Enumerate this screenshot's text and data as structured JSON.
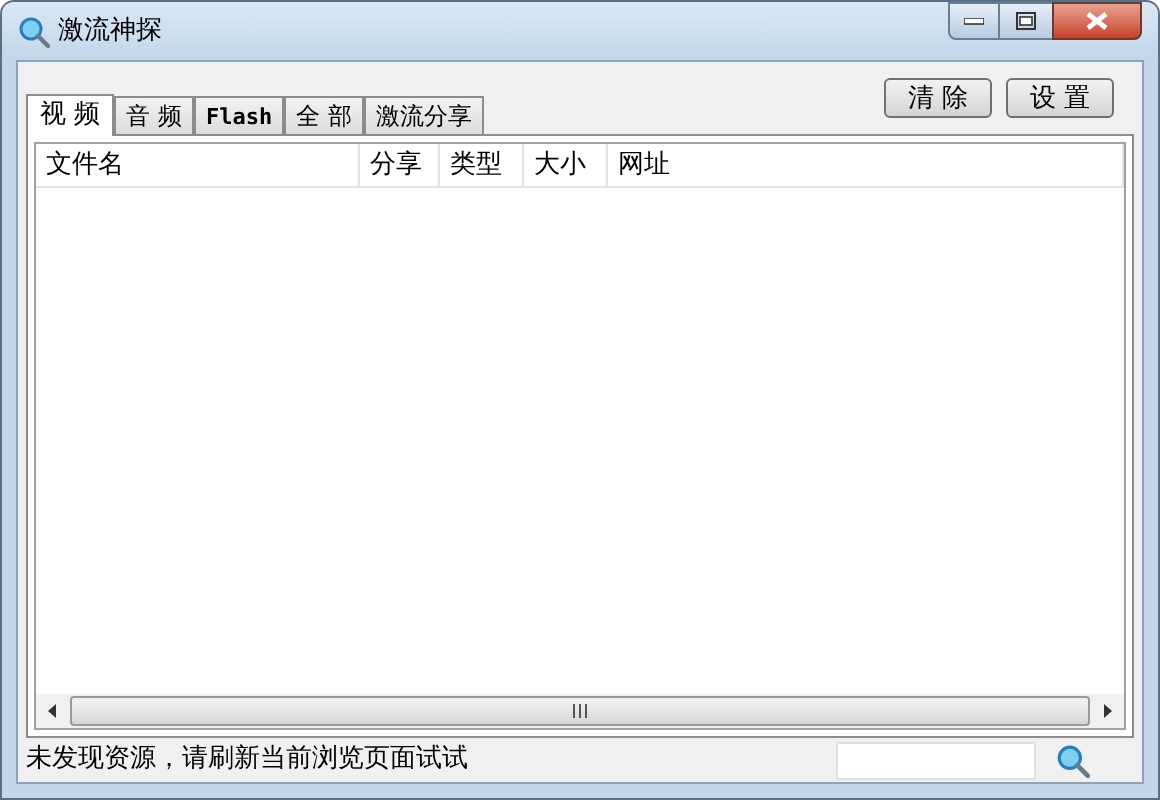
{
  "window": {
    "title": "激流神探"
  },
  "tabs": [
    {
      "label": "视 频",
      "selected": true
    },
    {
      "label": "音 频",
      "selected": false
    },
    {
      "label": "Flash",
      "selected": false
    },
    {
      "label": "全 部",
      "selected": false
    },
    {
      "label": "激流分享",
      "selected": false
    }
  ],
  "buttons": [
    "清 除",
    "设 置"
  ],
  "table": {
    "columns": [
      "文件名",
      "分享",
      "类型",
      "大小",
      "网址"
    ]
  },
  "status_bar": {
    "message": "未发现资源，请刷新当前浏览页面试试"
  }
}
